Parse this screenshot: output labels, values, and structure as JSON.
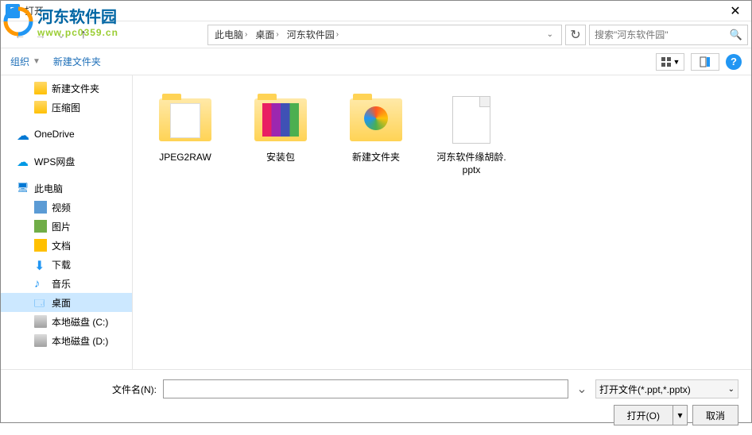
{
  "window": {
    "title": "打开"
  },
  "watermark": {
    "title": "河东软件园",
    "url": "www.pc0359.cn"
  },
  "breadcrumb": {
    "items": [
      "此电脑",
      "桌面",
      "河东软件园"
    ],
    "dropdown": "⌄",
    "refresh": "↻"
  },
  "search": {
    "placeholder": "搜索\"河东软件园\""
  },
  "toolbar": {
    "organize": "组织",
    "new_folder": "新建文件夹"
  },
  "sidebar": {
    "items": [
      {
        "label": "新建文件夹",
        "type": "folder",
        "indent": 1
      },
      {
        "label": "压缩图",
        "type": "folder",
        "indent": 1
      },
      {
        "label": "OneDrive",
        "type": "onedrive",
        "indent": 0
      },
      {
        "label": "WPS网盘",
        "type": "wps",
        "indent": 0
      },
      {
        "label": "此电脑",
        "type": "pc",
        "indent": 0
      },
      {
        "label": "视频",
        "type": "video",
        "indent": 1
      },
      {
        "label": "图片",
        "type": "pic",
        "indent": 1
      },
      {
        "label": "文档",
        "type": "doc",
        "indent": 1
      },
      {
        "label": "下载",
        "type": "dl",
        "indent": 1
      },
      {
        "label": "音乐",
        "type": "music",
        "indent": 1
      },
      {
        "label": "桌面",
        "type": "desktop",
        "indent": 1,
        "selected": true
      },
      {
        "label": "本地磁盘 (C:)",
        "type": "disk",
        "indent": 1
      },
      {
        "label": "本地磁盘 (D:)",
        "type": "disk",
        "indent": 1
      }
    ]
  },
  "files": [
    {
      "name": "JPEG2RAW",
      "thumb": "folder-paper"
    },
    {
      "name": "安装包",
      "thumb": "folder-rainbow"
    },
    {
      "name": "新建文件夹",
      "thumb": "folder-pinwheel"
    },
    {
      "name": "河东软件缘胡龄.pptx",
      "thumb": "doc"
    }
  ],
  "footer": {
    "filename_label": "文件名(N):",
    "filetype": "打开文件(*.ppt,*.pptx)",
    "open": "打开(O)",
    "cancel": "取消"
  }
}
